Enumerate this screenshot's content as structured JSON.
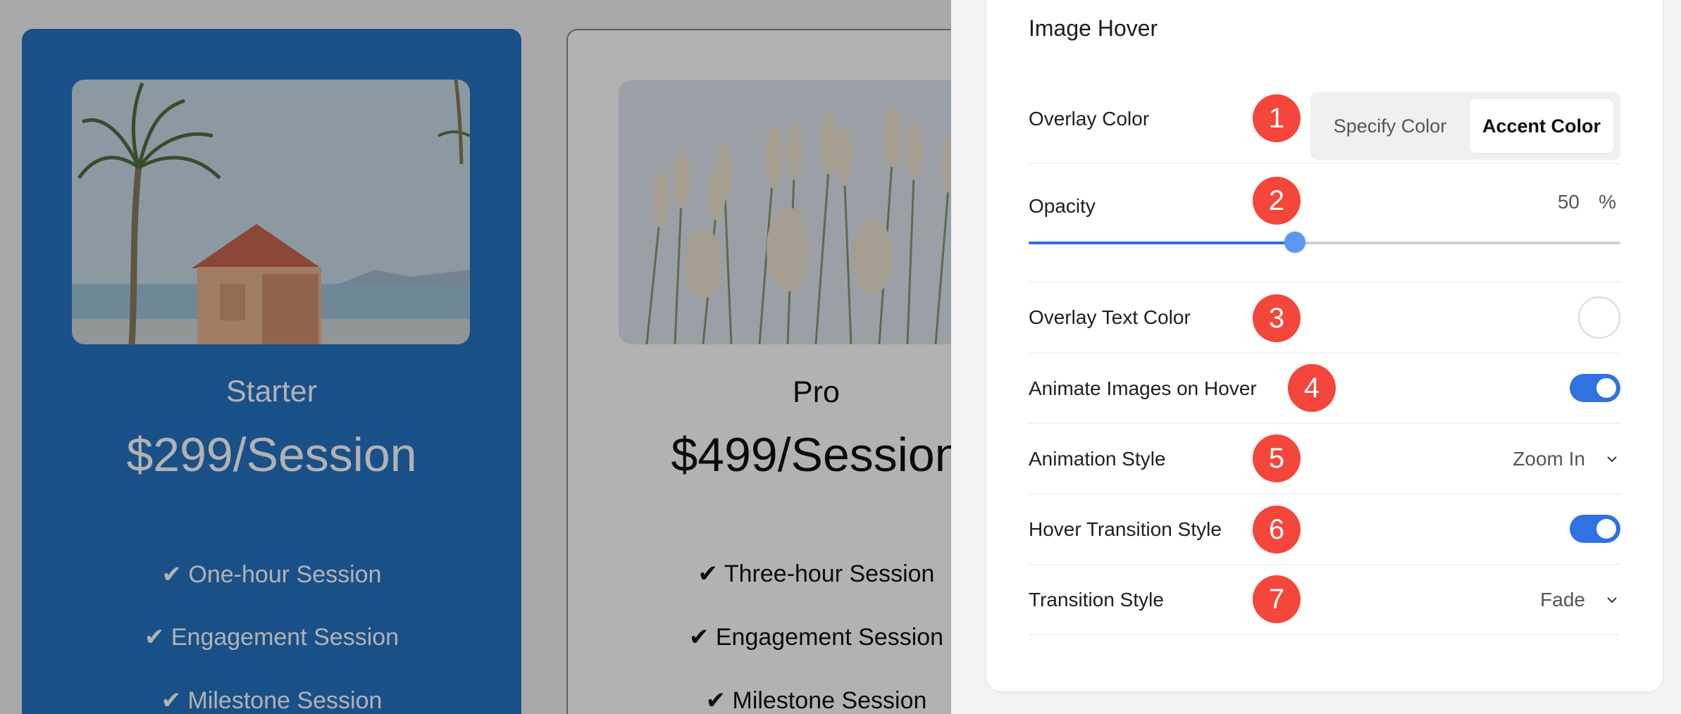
{
  "cards": [
    {
      "title": "Starter",
      "price": "$299/Session",
      "features": [
        "✔ One-hour Session",
        "✔ Engagement Session",
        "✔ Milestone Session"
      ],
      "background": "#2673c3"
    },
    {
      "title": "Pro",
      "price": "$499/Session",
      "features": [
        "✔ Three-hour Session",
        "✔ Engagement Session",
        "✔ Milestone Session"
      ],
      "background": "#ffffff"
    }
  ],
  "panel": {
    "title": "Image Hover",
    "overlay_color": {
      "label": "Overlay Color",
      "badge": "1",
      "options": [
        "Specify Color",
        "Accent Color"
      ],
      "selected": "Accent Color"
    },
    "opacity": {
      "label": "Opacity",
      "badge": "2",
      "value": "50",
      "unit": "%",
      "fraction": 0.45
    },
    "overlay_text_color": {
      "label": "Overlay Text Color",
      "badge": "3",
      "swatch_color": "#ffffff"
    },
    "animate_images": {
      "label": "Animate Images on Hover",
      "badge": "4",
      "enabled": true
    },
    "animation_style": {
      "label": "Animation Style",
      "badge": "5",
      "value": "Zoom In"
    },
    "hover_transition": {
      "label": "Hover Transition Style",
      "badge": "6",
      "enabled": true
    },
    "transition_style": {
      "label": "Transition Style",
      "badge": "7",
      "value": "Fade"
    }
  },
  "colors": {
    "badge": "#f4463a",
    "toggle_on": "#2f72e0",
    "accent_card": "#2673c3"
  }
}
